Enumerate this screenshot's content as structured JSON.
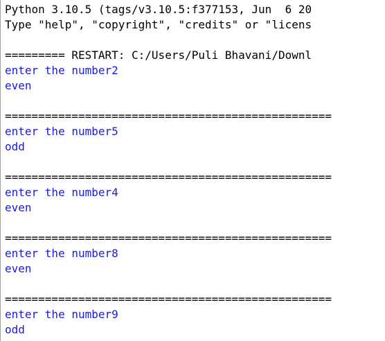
{
  "shell": {
    "banner": [
      "Python 3.10.5 (tags/v3.10.5:f377153, Jun  6 20",
      "Type \"help\", \"copyright\", \"credits\" or \"licens"
    ],
    "restart_line": "========= RESTART: C:/Users/Puli Bhavani/Downl",
    "separator": "=================================================",
    "runs": [
      {
        "prompt": "enter the number",
        "value": "2",
        "result": "even"
      },
      {
        "prompt": "enter the number",
        "value": "5",
        "result": "odd"
      },
      {
        "prompt": "enter the number",
        "value": "4",
        "result": "even"
      },
      {
        "prompt": "enter the number",
        "value": "8",
        "result": "even"
      },
      {
        "prompt": "enter the number",
        "value": "9",
        "result": "odd"
      }
    ]
  },
  "colors": {
    "stdout": "#1b1bd6",
    "text": "#000000"
  }
}
